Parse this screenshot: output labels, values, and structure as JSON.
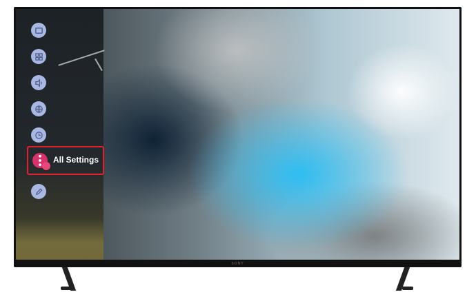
{
  "settings_menu": {
    "items": [
      {
        "icon": "picture-icon"
      },
      {
        "icon": "picture-mode-icon"
      },
      {
        "icon": "sound-icon"
      },
      {
        "icon": "network-icon"
      },
      {
        "icon": "clock-icon"
      },
      {
        "icon": "all-settings-icon",
        "label": "All Settings",
        "highlighted": true
      },
      {
        "icon": "edit-icon"
      }
    ]
  },
  "tv": {
    "brand": "SONY"
  },
  "colors": {
    "menu_button": "#a9b8e2",
    "selected_button": "#d6336c",
    "highlight_border": "#e0222f"
  }
}
